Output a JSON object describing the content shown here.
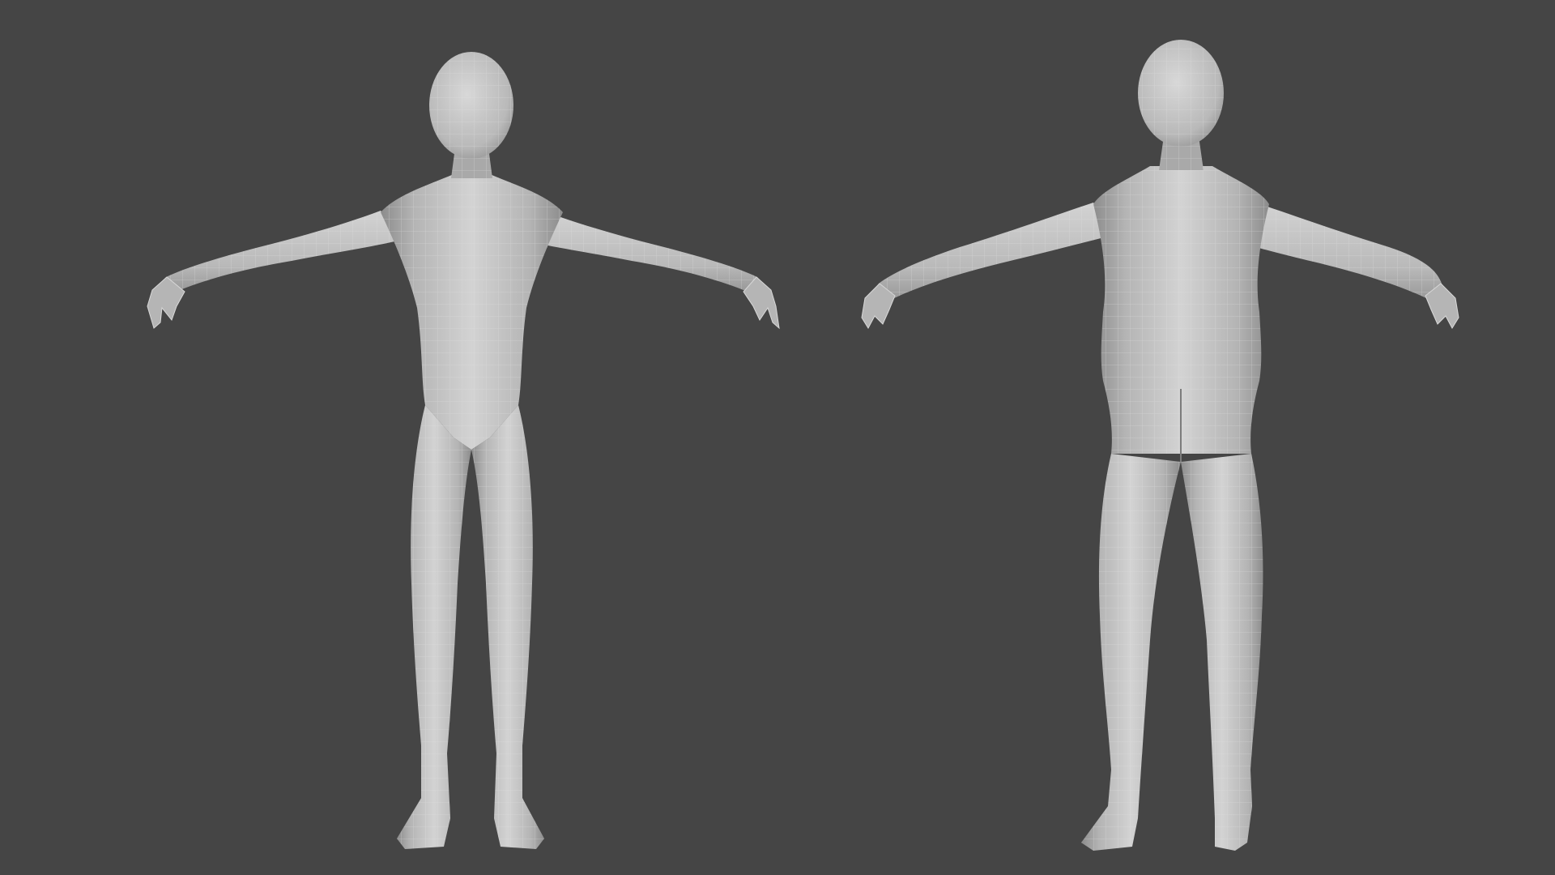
{
  "viewport": {
    "background_color": "#454545",
    "views": [
      {
        "id": "front",
        "name": "front-view"
      },
      {
        "id": "back",
        "name": "back-view"
      }
    ]
  },
  "model": {
    "base_color": "#b9b9b9",
    "light_color": "#d3d3d3",
    "shadow_color": "#8c8c8c",
    "wire_color": "#e2e2e2"
  }
}
